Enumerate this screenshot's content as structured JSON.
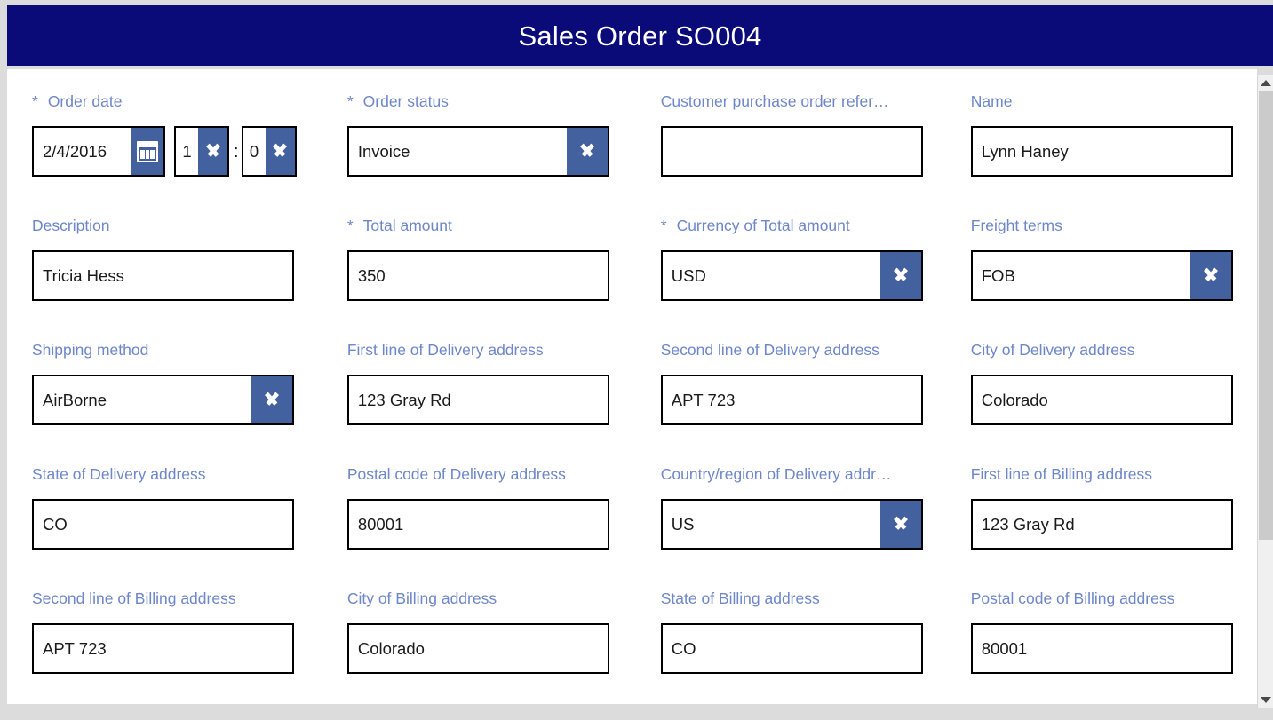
{
  "header": {
    "title": "Sales Order SO004"
  },
  "colors": {
    "header_bg": "#0a0a78",
    "header_text": "#ffffff",
    "label": "#6e87c9",
    "control_accent": "#44619f",
    "field_border": "#000000",
    "panel_bg": "#ffffff",
    "page_bg": "#dcdcdc"
  },
  "form": {
    "rows": [
      {
        "fields": [
          {
            "label": "Order date",
            "required": true,
            "type": "datetime",
            "date_value": "2/4/2016",
            "hour_value": "1",
            "separator": ":",
            "minute_value": "0",
            "calendar_icon": "calendar-icon",
            "chevron_icon": "chevron-down-icon"
          },
          {
            "label": "Order status",
            "required": true,
            "type": "select",
            "value": "Invoice",
            "chevron_icon": "chevron-down-icon"
          },
          {
            "label": "Customer purchase order refer…",
            "required": false,
            "type": "text",
            "value": ""
          },
          {
            "label": "Name",
            "required": false,
            "type": "text",
            "value": "Lynn Haney"
          }
        ]
      },
      {
        "fields": [
          {
            "label": "Description",
            "required": false,
            "type": "text",
            "value": "Tricia Hess"
          },
          {
            "label": "Total amount",
            "required": true,
            "type": "text",
            "value": "350"
          },
          {
            "label": "Currency of Total amount",
            "required": true,
            "type": "select",
            "value": "USD",
            "chevron_icon": "chevron-down-icon"
          },
          {
            "label": "Freight terms",
            "required": false,
            "type": "select",
            "value": "FOB",
            "chevron_icon": "chevron-down-icon"
          }
        ]
      },
      {
        "fields": [
          {
            "label": "Shipping method",
            "required": false,
            "type": "select",
            "value": "AirBorne",
            "chevron_icon": "chevron-down-icon"
          },
          {
            "label": "First line of Delivery address",
            "required": false,
            "type": "text",
            "value": "123 Gray Rd"
          },
          {
            "label": "Second line of Delivery address",
            "required": false,
            "type": "text",
            "value": "APT 723"
          },
          {
            "label": "City of Delivery address",
            "required": false,
            "type": "text",
            "value": "Colorado"
          }
        ]
      },
      {
        "fields": [
          {
            "label": "State of Delivery address",
            "required": false,
            "type": "text",
            "value": "CO"
          },
          {
            "label": "Postal code of Delivery address",
            "required": false,
            "type": "text",
            "value": "80001"
          },
          {
            "label": "Country/region of Delivery addr…",
            "required": false,
            "type": "select",
            "value": "US",
            "chevron_icon": "chevron-down-icon"
          },
          {
            "label": "First line of Billing address",
            "required": false,
            "type": "text",
            "value": "123 Gray Rd"
          }
        ]
      },
      {
        "fields": [
          {
            "label": "Second line of Billing address",
            "required": false,
            "type": "text",
            "value": "APT 723"
          },
          {
            "label": "City of Billing address",
            "required": false,
            "type": "text",
            "value": "Colorado"
          },
          {
            "label": "State of Billing address",
            "required": false,
            "type": "text",
            "value": "CO"
          },
          {
            "label": "Postal code of Billing address",
            "required": false,
            "type": "text",
            "value": "80001"
          }
        ]
      }
    ]
  },
  "scrollbar": {
    "up_icon": "scroll-up-arrow-icon",
    "down_icon": "scroll-down-arrow-icon"
  },
  "required_marker": "*"
}
